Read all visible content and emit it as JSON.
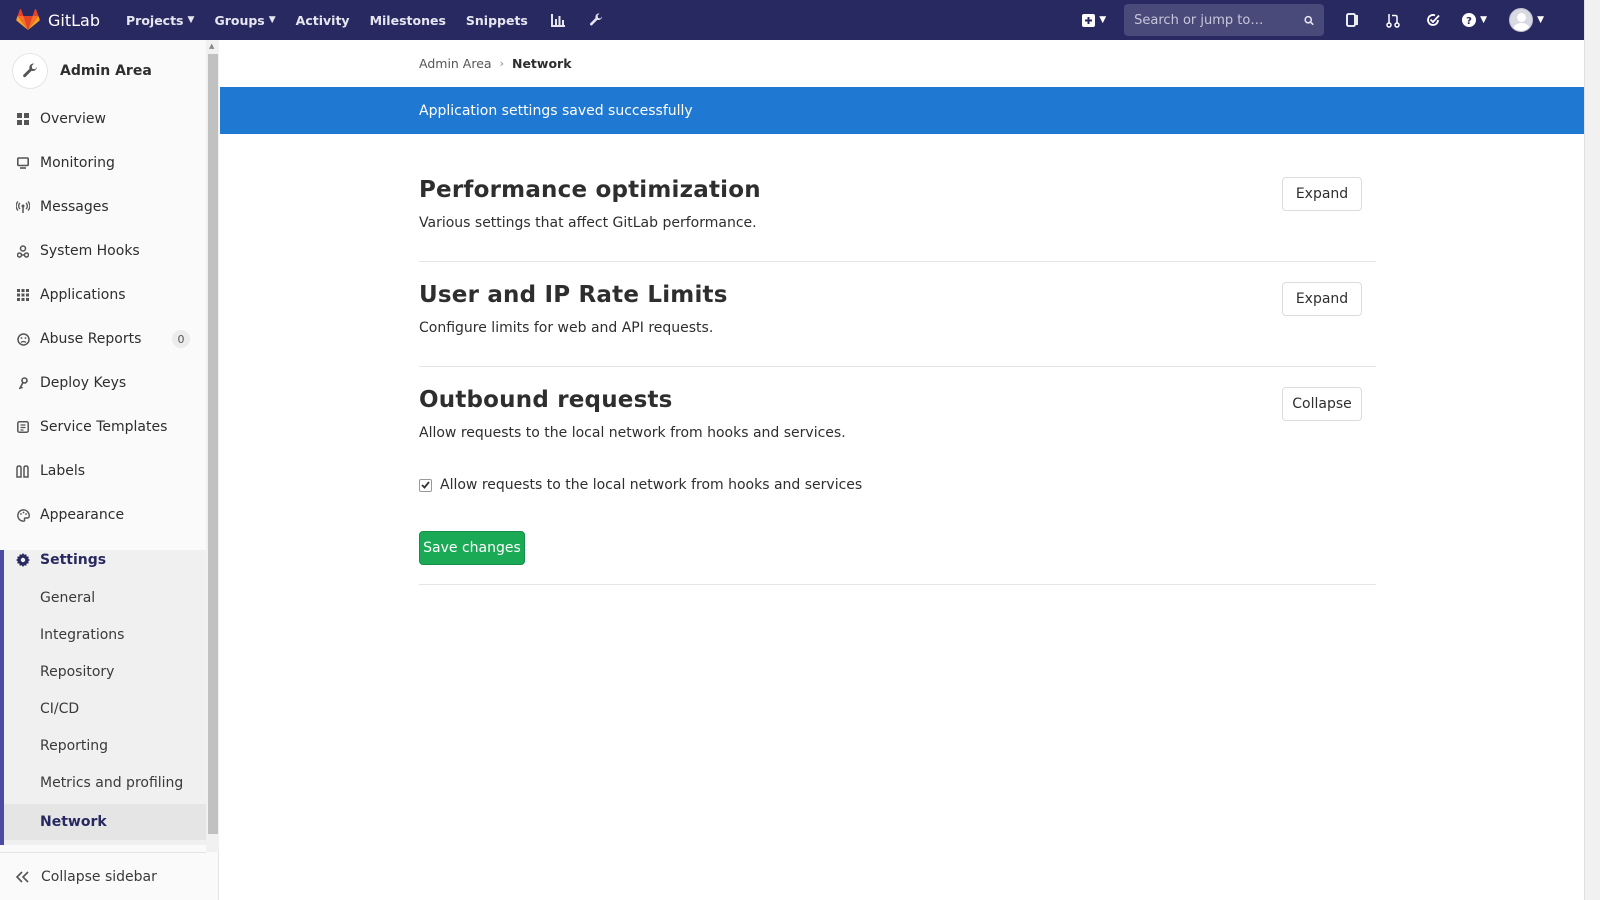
{
  "navbar": {
    "brand": "GitLab",
    "links": [
      {
        "label": "Projects",
        "dropdown": true
      },
      {
        "label": "Groups",
        "dropdown": true
      },
      {
        "label": "Activity",
        "dropdown": false
      },
      {
        "label": "Milestones",
        "dropdown": false
      },
      {
        "label": "Snippets",
        "dropdown": false
      }
    ],
    "icons": [
      "chart-icon",
      "wrench-icon"
    ],
    "search_placeholder": "Search or jump to…",
    "right_icons": [
      "plus-square-icon",
      "issues-icon",
      "merge-request-icon",
      "todo-icon",
      "help-icon",
      "avatar"
    ]
  },
  "sidebar": {
    "title": "Admin Area",
    "items": [
      {
        "label": "Overview",
        "icon": "overview-icon"
      },
      {
        "label": "Monitoring",
        "icon": "monitor-icon"
      },
      {
        "label": "Messages",
        "icon": "broadcast-icon"
      },
      {
        "label": "System Hooks",
        "icon": "hook-icon"
      },
      {
        "label": "Applications",
        "icon": "apps-icon"
      },
      {
        "label": "Abuse Reports",
        "icon": "abuse-icon",
        "badge": "0"
      },
      {
        "label": "Deploy Keys",
        "icon": "key-icon"
      },
      {
        "label": "Service Templates",
        "icon": "template-icon"
      },
      {
        "label": "Labels",
        "icon": "label-icon"
      },
      {
        "label": "Appearance",
        "icon": "palette-icon"
      }
    ],
    "settings": {
      "label": "Settings",
      "sub": [
        "General",
        "Integrations",
        "Repository",
        "CI/CD",
        "Reporting",
        "Metrics and profiling",
        "Network"
      ],
      "active_sub": "Network"
    },
    "collapse_label": "Collapse sidebar"
  },
  "breadcrumb": {
    "parent": "Admin Area",
    "current": "Network"
  },
  "flash": "Application settings saved successfully",
  "sections": [
    {
      "title": "Performance optimization",
      "desc": "Various settings that affect GitLab performance.",
      "button": "Expand"
    },
    {
      "title": "User and IP Rate Limits",
      "desc": "Configure limits for web and API requests.",
      "button": "Expand"
    },
    {
      "title": "Outbound requests",
      "desc": "Allow requests to the local network from hooks and services.",
      "button": "Collapse"
    }
  ],
  "outbound": {
    "checkbox_label": "Allow requests to the local network from hooks and services",
    "checked": true,
    "save_label": "Save changes"
  },
  "colors": {
    "navbar": "#292961",
    "flash": "#1f78d1",
    "save": "#1aaa55"
  }
}
